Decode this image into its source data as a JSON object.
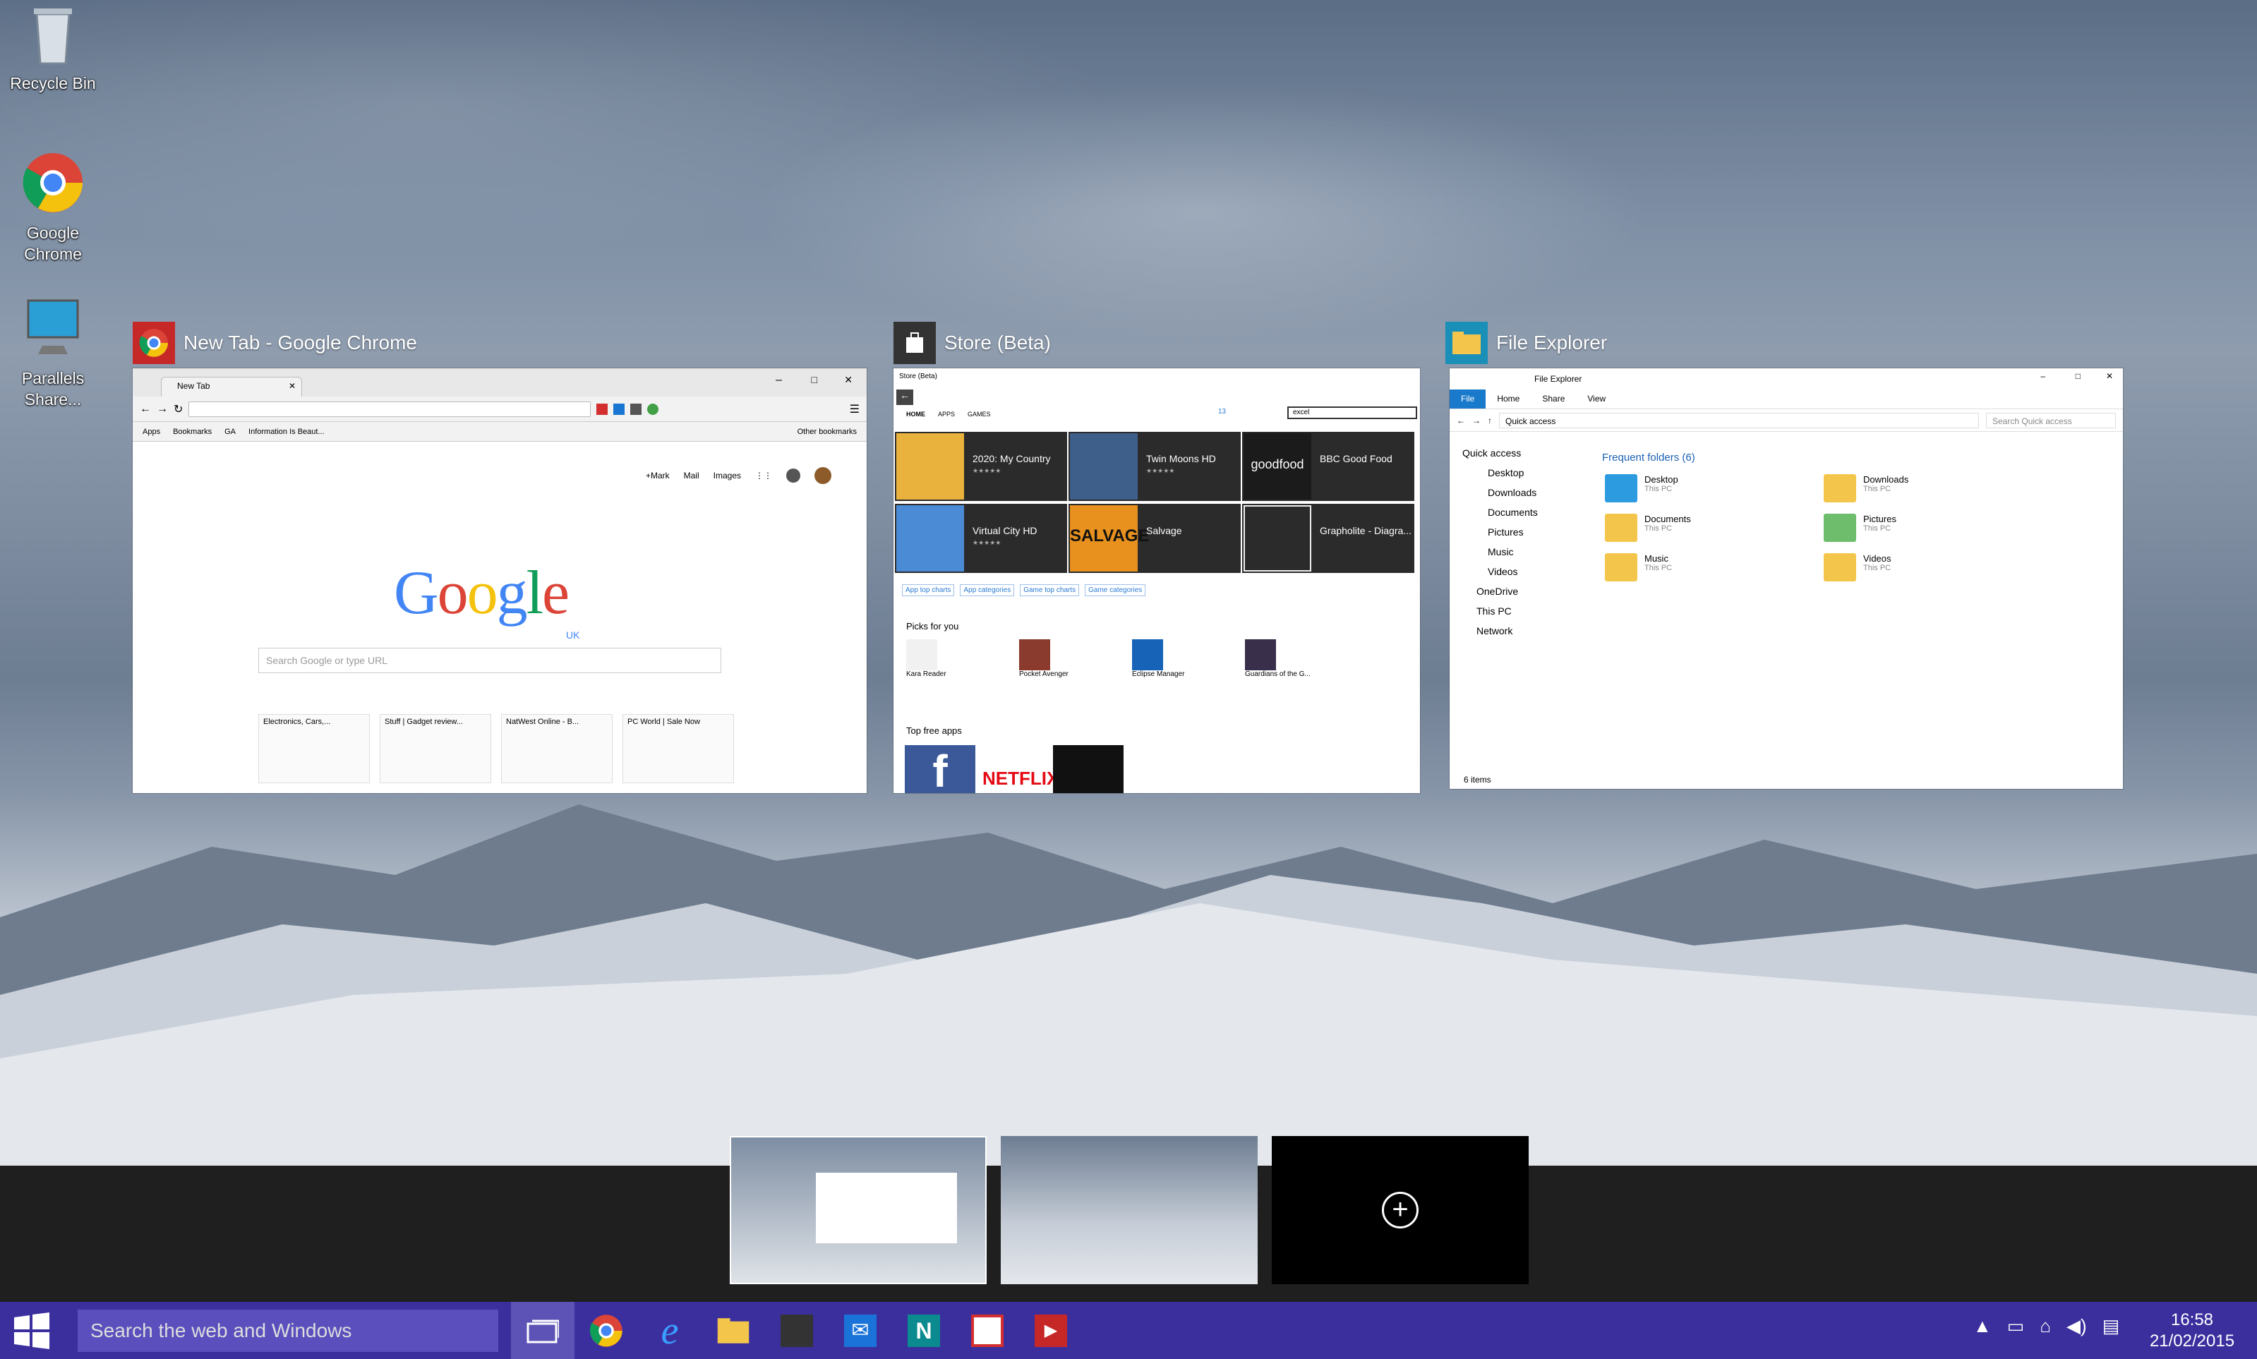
{
  "desktop_icons": [
    {
      "label": "Recycle Bin",
      "icon": "recycle-bin-icon"
    },
    {
      "label": "Google Chrome",
      "icon": "chrome-shortcut-icon"
    },
    {
      "label": "Parallels Share...",
      "icon": "parallels-share-icon"
    }
  ],
  "windows": {
    "chrome": {
      "title": "New Tab - Google Chrome",
      "tab_label": "New Tab",
      "bookmarks": [
        "Apps",
        "Bookmarks",
        "GA",
        "Information Is Beaut..."
      ],
      "other_bookmarks": "Other bookmarks",
      "top_links": [
        "+Mark",
        "Mail",
        "Images"
      ],
      "logo": "Google",
      "logo_sub": "UK",
      "search_placeholder": "Search Google or type URL",
      "tiles": [
        "Electronics, Cars,...",
        "Stuff | Gadget review...",
        "NatWest Online - B...",
        "PC World | Sale Now"
      ]
    },
    "store": {
      "title": "Store (Beta)",
      "window_label": "Store (Beta)",
      "nav": [
        "HOME",
        "APPS",
        "GAMES"
      ],
      "downloads": "13",
      "search_value": "excel",
      "apps": [
        {
          "name": "2020: My Country"
        },
        {
          "name": "Twin Moons HD"
        },
        {
          "name": "BBC Good Food",
          "logo": "goodfood"
        },
        {
          "name": "Virtual City HD"
        },
        {
          "name": "Salvage",
          "logo": "SALVAGE"
        },
        {
          "name": "Grapholite - Diagra..."
        }
      ],
      "links": [
        "App top charts",
        "App categories",
        "Game top charts",
        "Game categories"
      ],
      "picks_heading": "Picks for you",
      "picks": [
        "Kara Reader",
        "Pocket Avenger",
        "Eclipse Manager",
        "Guardians of the G..."
      ],
      "top_free_heading": "Top free apps",
      "top_free": [
        "NETFLIX"
      ]
    },
    "explorer": {
      "title": "File Explorer",
      "window_label": "File Explorer",
      "ribbon": [
        "File",
        "Home",
        "Share",
        "View"
      ],
      "address": "Quick access",
      "search_placeholder": "Search Quick access",
      "sidebar": [
        "Quick access",
        "Desktop",
        "Downloads",
        "Documents",
        "Pictures",
        "Music",
        "Videos",
        "OneDrive",
        "This PC",
        "Network"
      ],
      "section": "Frequent folders (6)",
      "folders": [
        {
          "name": "Desktop",
          "loc": "This PC"
        },
        {
          "name": "Downloads",
          "loc": "This PC"
        },
        {
          "name": "Documents",
          "loc": "This PC"
        },
        {
          "name": "Pictures",
          "loc": "This PC"
        },
        {
          "name": "Music",
          "loc": "This PC"
        },
        {
          "name": "Videos",
          "loc": "This PC"
        }
      ],
      "status": "6 items"
    }
  },
  "virtual_desktops": {
    "new_desktop": "+"
  },
  "taskbar": {
    "search_placeholder": "Search the web and Windows",
    "time": "16:58",
    "date": "21/02/2015",
    "apps": [
      "task-view-icon",
      "chrome-icon",
      "internet-explorer-icon",
      "file-explorer-icon",
      "store-icon",
      "mail-icon",
      "nextgen-reader-icon",
      "todo-icon",
      "video-icon"
    ]
  }
}
